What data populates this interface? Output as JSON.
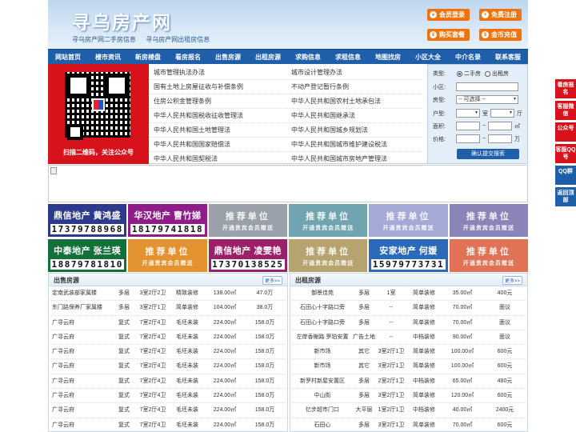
{
  "header": {
    "logo": "寻乌房产网",
    "slogan": [
      "寻乌房产网二手房信息",
      "寻乌房产网出租房信息"
    ],
    "buttons": [
      {
        "label": "会员登录",
        "icon": "user-icon"
      },
      {
        "label": "免费注册",
        "icon": "user-add-icon"
      },
      {
        "label": "购买套餐",
        "icon": "cart-icon"
      },
      {
        "label": "金币充值",
        "icon": "coin-icon"
      }
    ]
  },
  "nav": [
    "网站首页",
    "楼市资讯",
    "新房楼盘",
    "看房报名",
    "出售房源",
    "出租房源",
    "求购信息",
    "求租信息",
    "地图找房",
    "小区大全",
    "中介名录",
    "联系客服"
  ],
  "qr": {
    "caption": "扫描二维码，关注公众号"
  },
  "links": {
    "left": [
      "城市管理执法办法",
      "国有土地上房屋征收与补偿条例",
      "住房公积金管理条例",
      "中华人民共和国税收征收管理法",
      "中华人民共和国土地管理法",
      "中华人民共和国国家赔偿法",
      "中华人民共和国契税法"
    ],
    "right": [
      "城市设计管理办法",
      "不动产登记暂行条例",
      "中华人民共和国农村土地承包法",
      "中华人民共和国继承法",
      "中华人民共和国城乡规划法",
      "中华人民共和国城市维护建设税法",
      "中华人民共和国城市房地产管理法"
    ]
  },
  "search": {
    "type_label": "类型:",
    "type_options": [
      "二手房",
      "出租房"
    ],
    "community_label": "小区:",
    "housetype_label": "房型:",
    "housetype_value": "-- 可选择 --",
    "layout_label": "户型:",
    "room_label": "室",
    "hall_label": "厅",
    "area_label": "面积:",
    "area_unit": "㎡",
    "price_label": "价格:",
    "price_unit": "万",
    "tilde": "~",
    "submit": "确认提交搜索"
  },
  "ads": [
    {
      "t1": "鼎信地产 黄鸿盛",
      "t2": "17379788968",
      "color": "#2d3a8c",
      "kind": "real"
    },
    {
      "t1": "华汉地产 曹竹娣",
      "t2": "18179741818",
      "color": "#8e1d8a",
      "kind": "real"
    },
    {
      "t1": "推荐单位",
      "t2": "开通贵宾会员赠送",
      "color": "#9aa1aa",
      "kind": "promo"
    },
    {
      "t1": "推荐单位",
      "t2": "开通贵宾会员赠送",
      "color": "#6fa4b0",
      "kind": "promo"
    },
    {
      "t1": "推荐单位",
      "t2": "开通贵宾会员赠送",
      "color": "#a4a9d6",
      "kind": "promo"
    },
    {
      "t1": "推荐单位",
      "t2": "开通贵宾会员赠送",
      "color": "#8a84b8",
      "kind": "promo"
    },
    {
      "t1": "中泰地产 张兰瑛",
      "t2": "18879781810",
      "color": "#14703a",
      "kind": "real"
    },
    {
      "t1": "推荐单位",
      "t2": "开通贵宾会员赠送",
      "color": "#e2932f",
      "kind": "promo"
    },
    {
      "t1": "鼎信地产 凌雯艳",
      "t2": "17370138525",
      "color": "#9c1f6a",
      "kind": "real"
    },
    {
      "t1": "推荐单位",
      "t2": "开通贵宾会员赠送",
      "color": "#b7a36f",
      "kind": "promo"
    },
    {
      "t1": "安家地产 何媛",
      "t2": "15979773731",
      "color": "#2b6ab8",
      "kind": "real"
    },
    {
      "t1": "推荐单位",
      "t2": "开通贵宾会员赠送",
      "color": "#e07255",
      "kind": "promo"
    }
  ],
  "sale": {
    "title": "出售房源",
    "more": "更多>>",
    "rows": [
      [
        "定南武装部家属楼",
        "多层",
        "3室2厅2卫",
        "精致装修",
        "138.00㎡",
        "47.0万"
      ],
      [
        "东门路保养厂家属楼",
        "多层",
        "3室2厅1卫",
        "简单装修",
        "104.00㎡",
        "38.0万"
      ],
      [
        "广寻云府",
        "复式",
        "7室2厅4卫",
        "毛坯未装",
        "224.00㎡",
        "158.0万"
      ],
      [
        "广寻云府",
        "复式",
        "7室2厅4卫",
        "毛坯未装",
        "224.00㎡",
        "158.0万"
      ],
      [
        "广寻云府",
        "复式",
        "7室2厅4卫",
        "毛坯未装",
        "224.00㎡",
        "158.0万"
      ],
      [
        "广寻云府",
        "复式",
        "7室2厅4卫",
        "毛坯未装",
        "224.00㎡",
        "158.0万"
      ],
      [
        "广寻云府",
        "复式",
        "7室2厅4卫",
        "毛坯未装",
        "224.00㎡",
        "158.0万"
      ],
      [
        "广寻云府",
        "复式",
        "7室2厅4卫",
        "毛坯未装",
        "224.00㎡",
        "158.0万"
      ],
      [
        "广寻云府",
        "复式",
        "7室2厅4卫",
        "毛坯未装",
        "224.00㎡",
        "158.0万"
      ],
      [
        "广寻云府",
        "复式",
        "7室2厅4卫",
        "毛坯未装",
        "224.00㎡",
        "158.0万"
      ]
    ]
  },
  "rent": {
    "title": "出租房源",
    "more": "更多>>",
    "rows": [
      [
        "御景佳苑",
        "多层",
        "1室",
        "简单装修",
        "35.00㎡",
        "400元"
      ],
      [
        "石田心十字路口旁",
        "多层",
        "--",
        "简单装修",
        "70.00㎡",
        "面议"
      ],
      [
        "石田心十字路口旁",
        "多层",
        "--",
        "简单装修",
        "70.00㎡",
        "面议"
      ],
      [
        "左岸香榭路 罗珀安置",
        "广告土地",
        "--",
        "中档装修",
        "90.00㎡",
        "面议"
      ],
      [
        "新市场",
        "其它",
        "3室2厅1卫",
        "简单装修",
        "100.00㎡",
        "600元"
      ],
      [
        "新市场",
        "其它",
        "3室2厅1卫",
        "简单装修",
        "100.00㎡",
        "600元"
      ],
      [
        "新罗村新屋安置区",
        "多层",
        "2室2厅1卫",
        "中档装修",
        "65.00㎡",
        "480元"
      ],
      [
        "中山街",
        "多层",
        "3室2厅1卫",
        "简单装修",
        "120.00㎡",
        "600元"
      ],
      [
        "忆步超市门口",
        "大平层",
        "1室2厅1卫",
        "中档装修",
        "40.00㎡",
        "2400元"
      ],
      [
        "石田心",
        "多层",
        "3室2厅1卫",
        "简单装修",
        "70.00㎡",
        "600元"
      ]
    ]
  },
  "side": [
    "看房报名",
    "客服微信",
    "公众号",
    "客服QQ号",
    "QQ群",
    "返回顶部"
  ]
}
